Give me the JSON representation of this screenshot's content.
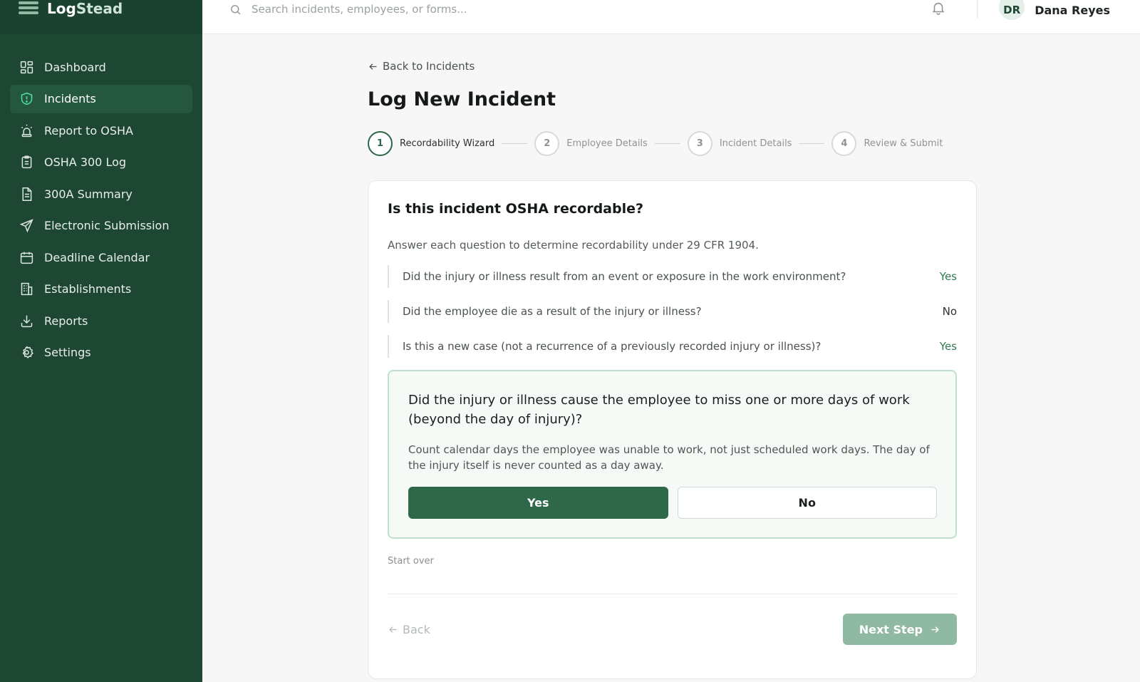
{
  "app": {
    "brand_prefix": "Log",
    "brand_suffix": "Stead"
  },
  "sidebar": {
    "items": [
      {
        "label": "Dashboard",
        "icon": "dashboard-icon",
        "active": false
      },
      {
        "label": "Incidents",
        "icon": "shield-alert-icon",
        "active": true
      },
      {
        "label": "Report to OSHA",
        "icon": "siren-icon",
        "active": false
      },
      {
        "label": "OSHA 300 Log",
        "icon": "clipboard-icon",
        "active": false
      },
      {
        "label": "300A Summary",
        "icon": "document-icon",
        "active": false
      },
      {
        "label": "Electronic Submission",
        "icon": "send-icon",
        "active": false
      },
      {
        "label": "Deadline Calendar",
        "icon": "calendar-icon",
        "active": false
      },
      {
        "label": "Establishments",
        "icon": "building-icon",
        "active": false
      },
      {
        "label": "Reports",
        "icon": "download-icon",
        "active": false
      },
      {
        "label": "Settings",
        "icon": "gear-icon",
        "active": false
      }
    ]
  },
  "topbar": {
    "search_placeholder": "Search incidents, employees, or forms...",
    "user_initials": "DR",
    "user_name": "Dana Reyes"
  },
  "page": {
    "back_link": "Back to Incidents",
    "title": "Log New Incident"
  },
  "stepper": {
    "steps": [
      {
        "number": "1",
        "label": "Recordability Wizard",
        "active": true
      },
      {
        "number": "2",
        "label": "Employee Details",
        "active": false
      },
      {
        "number": "3",
        "label": "Incident Details",
        "active": false
      },
      {
        "number": "4",
        "label": "Review & Submit",
        "active": false
      }
    ]
  },
  "wizard": {
    "title": "Is this incident OSHA recordable?",
    "description": "Answer each question to determine recordability under 29 CFR 1904.",
    "answered": [
      {
        "question": "Did the injury or illness result from an event or exposure in the work environment?",
        "answer": "Yes"
      },
      {
        "question": "Did the employee die as a result of the injury or illness?",
        "answer": "No"
      },
      {
        "question": "Is this a new case (not a recurrence of a previously recorded injury or illness)?",
        "answer": "Yes"
      }
    ],
    "current_question": "Did the injury or illness cause the employee to miss one or more days of work (beyond the day of injury)?",
    "current_hint": "Count calendar days the employee was unable to work, not just scheduled work days. The day of the injury itself is never counted as a day away.",
    "yes_label": "Yes",
    "no_label": "No",
    "start_over": "Start over",
    "back_label": "Back",
    "next_label": "Next Step"
  },
  "colors": {
    "sidebar_bg": "#1e4733",
    "primary": "#2f6749",
    "accent_yes": "#2e7a52",
    "next_disabled": "#8fb9a2"
  }
}
